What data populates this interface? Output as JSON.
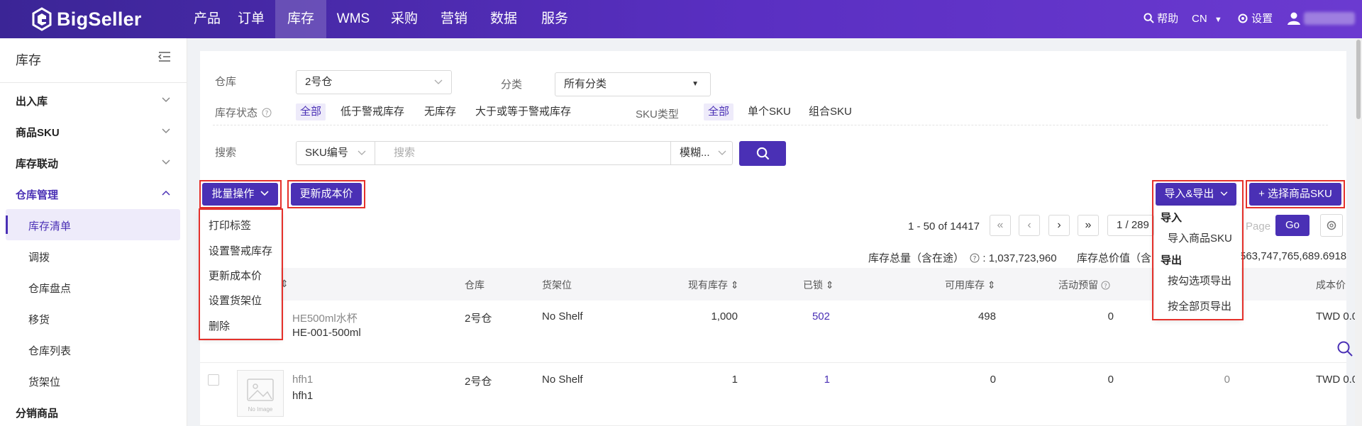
{
  "brand": {
    "name": "BigSeller",
    "accent": "#4a30b5"
  },
  "nav": {
    "items": [
      "产品",
      "订单",
      "库存",
      "WMS",
      "采购",
      "营销",
      "数据",
      "服务"
    ],
    "active": "库存",
    "help": "帮助",
    "lang": "CN",
    "settings": "设置"
  },
  "sidebar": {
    "title": "库存",
    "groups": [
      {
        "label": "出入库"
      },
      {
        "label": "商品SKU"
      },
      {
        "label": "库存联动"
      },
      {
        "label": "仓库管理",
        "open": true
      }
    ],
    "sub_items": [
      "库存清单",
      "调拨",
      "仓库盘点",
      "移货",
      "仓库列表",
      "货架位"
    ],
    "active_sub": "库存清单",
    "bottom_group": "分销商品"
  },
  "filters": {
    "warehouse_label": "仓库",
    "warehouse_value": "2号仓",
    "category_label": "分类",
    "category_value": "所有分类",
    "stock_status_label": "库存状态",
    "stock_status_options": [
      "全部",
      "低于警戒库存",
      "无库存",
      "大于或等于警戒库存"
    ],
    "sku_type_label": "SKU类型",
    "sku_type_options": [
      "全部",
      "单个SKU",
      "组合SKU"
    ],
    "search_label": "搜索",
    "search_field": "SKU编号",
    "search_placeholder": "搜索",
    "match_mode": "模糊..."
  },
  "actions": {
    "bulk": "批量操作",
    "update_cost": "更新成本价",
    "import_export": "导入&导出",
    "select_sku": "+ 选择商品SKU"
  },
  "bulk_menu": [
    "打印标签",
    "设置警戒库存",
    "更新成本价",
    "设置货架位",
    "删除"
  ],
  "import_export_menu": {
    "import_title": "导入",
    "import_items": [
      "导入商品SKU"
    ],
    "export_title": "导出",
    "export_items": [
      "按勾选项导出",
      "按全部页导出"
    ]
  },
  "pager": {
    "range": "1 - 50 of 14417",
    "page": "1 / 289",
    "page_placeholder": "Page",
    "go": "Go"
  },
  "totals": {
    "qty_label": "库存总量（含在途）",
    "qty_value": ": 1,037,723,960",
    "value_label": "库存总价值（含",
    "value_value": "563,747,765,689.6918"
  },
  "table": {
    "headers": [
      "仓库",
      "货架位",
      "现有库存",
      "已锁",
      "可用库存",
      "活动预留",
      "成本价"
    ],
    "rows": [
      {
        "name": "HE500ml水杯",
        "sku": "HE-001-500ml",
        "warehouse": "2号仓",
        "shelf": "No Shelf",
        "on_hand": "1,000",
        "locked": "502",
        "available": "498",
        "reserved": "0",
        "cost": "TWD 0.0"
      },
      {
        "name": "hfh1",
        "sku": "hfh1",
        "warehouse": "2号仓",
        "shelf": "No Shelf",
        "on_hand": "1",
        "locked": "1",
        "available": "0",
        "reserved": "0",
        "extra": "0",
        "cost": "TWD 0.0",
        "image_text": "No Image"
      }
    ]
  }
}
